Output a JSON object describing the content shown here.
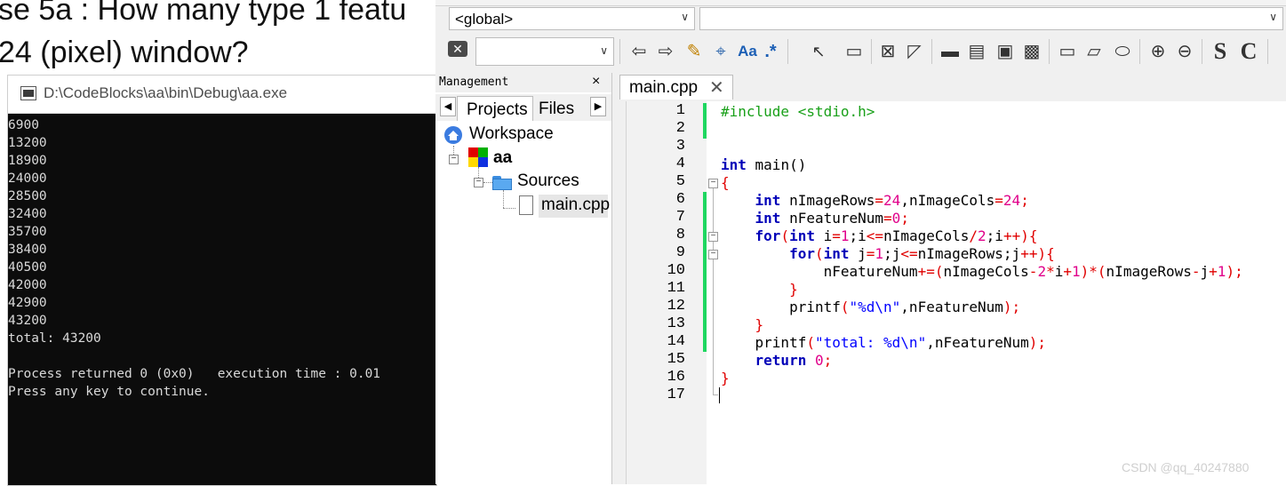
{
  "background": {
    "line1": "se   5a : How many type 1 featu",
    "line2": "24 (pixel) window?"
  },
  "console": {
    "title": "D:\\CodeBlocks\\aa\\bin\\Debug\\aa.exe",
    "lines": [
      "6900",
      "13200",
      "18900",
      "24000",
      "28500",
      "32400",
      "35700",
      "38400",
      "40500",
      "42000",
      "42900",
      "43200",
      "total: 43200",
      "",
      "Process returned 0 (0x0)   execution time : 0.01",
      "Press any key to continue."
    ]
  },
  "toolbar": {
    "scope_value": "<global>",
    "symbol_value": "",
    "search_value": "",
    "match_case_label": "Aa",
    "regex_label": ".*",
    "s_label": "S",
    "c_label": "C"
  },
  "management": {
    "title": "Management",
    "close": "×",
    "tabs": [
      "Projects",
      "Files"
    ],
    "tree": {
      "workspace": "Workspace",
      "project": "aa",
      "folder": "Sources",
      "file": "main.cpp"
    }
  },
  "editor": {
    "tab_label": "main.cpp",
    "tab_close": "✕",
    "line_numbers": [
      "1",
      "2",
      "3",
      "4",
      "5",
      "6",
      "7",
      "8",
      "9",
      "10",
      "11",
      "12",
      "13",
      "14",
      "15",
      "16",
      "17"
    ]
  },
  "code": {
    "l1": "#include <stdio.h>",
    "l4_kw": "int",
    "l4_rest": " main()",
    "l5": "{",
    "l6_kw": "int",
    "l6_a": " nImageRows",
    "l6_b": "=",
    "l6_c": "24",
    "l6_d": ",nImageCols",
    "l6_e": "=",
    "l6_f": "24",
    "l6_g": ";",
    "l7_kw": "int",
    "l7_a": " nFeatureNum",
    "l7_b": "=",
    "l7_c": "0",
    "l7_d": ";",
    "l8_for": "for",
    "l8_p": "(",
    "l8_int": "int",
    "l8_a": " i",
    "l8_b": "=",
    "l8_c": "1",
    "l8_d": ";i",
    "l8_e": "<=",
    "l8_f": "nImageCols",
    "l8_g": "/",
    "l8_h": "2",
    "l8_i": ";i",
    "l8_j": "++){",
    "l9_for": "for",
    "l9_p": "(",
    "l9_int": "int",
    "l9_a": " j",
    "l9_b": "=",
    "l9_c": "1",
    "l9_d": ";j",
    "l9_e": "<=",
    "l9_f": "nImageRows;j",
    "l9_g": "++){",
    "l10_a": "nFeatureNum",
    "l10_b": "+=(",
    "l10_c": "nImageCols",
    "l10_d": "-",
    "l10_e": "2",
    "l10_f": "*",
    "l10_g": "i",
    "l10_h": "+",
    "l10_i": "1",
    "l10_j": ")*(",
    "l10_k": "nImageRows",
    "l10_l": "-",
    "l10_m": "j",
    "l10_n": "+",
    "l10_o": "1",
    "l10_p": ");",
    "l11": "}",
    "l12_a": "printf",
    "l12_b": "(",
    "l12_c": "\"%d\\n\"",
    "l12_d": ",nFeatureNum",
    "l12_e": ");",
    "l13": "}",
    "l14_a": "printf",
    "l14_b": "(",
    "l14_c": "\"total: %d\\n\"",
    "l14_d": ",nFeatureNum",
    "l14_e": ");",
    "l15_kw": "return",
    "l15_a": " ",
    "l15_b": "0",
    "l15_c": ";",
    "l16": "}"
  },
  "watermark": "CSDN @qq_40247880",
  "colors": {
    "keyword": "#0000b8",
    "operator": "#e00000",
    "number": "#e0008a",
    "string": "#0000ff",
    "preprocessor": "#19a019",
    "changebar": "#1ed760"
  }
}
